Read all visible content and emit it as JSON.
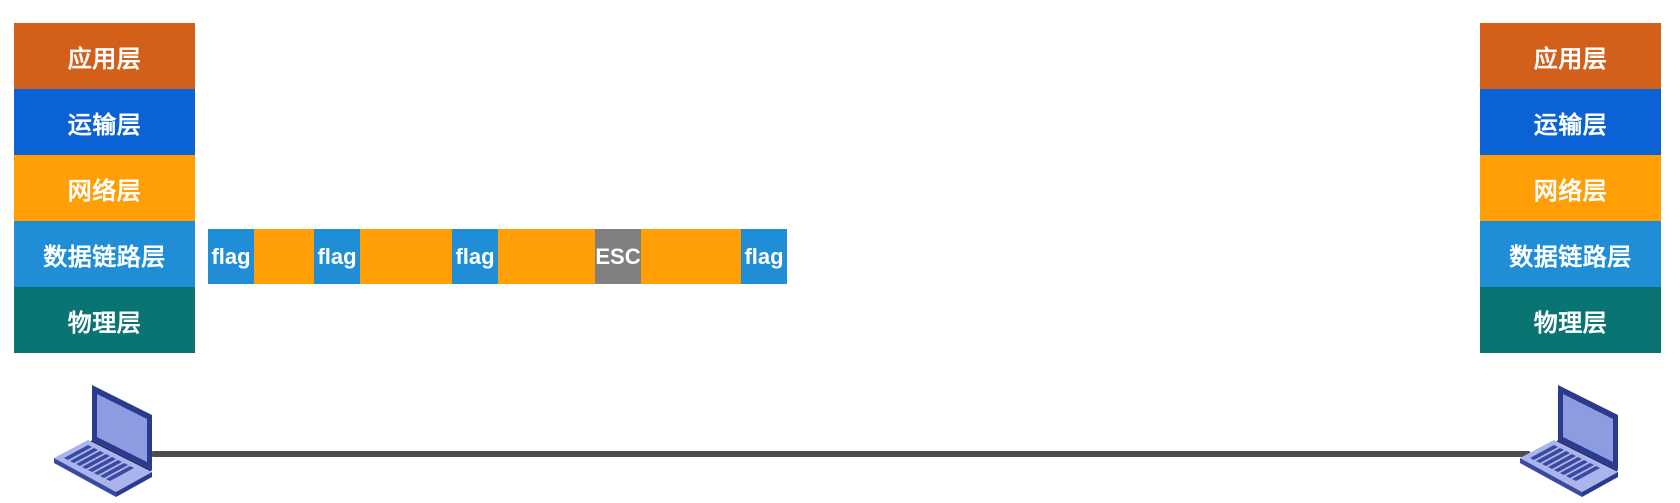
{
  "left_stack": {
    "layers": [
      {
        "label": "应用层",
        "color": "#d2601a"
      },
      {
        "label": "运输层",
        "color": "#0b62d4"
      },
      {
        "label": "网络层",
        "color": "#ff9f05"
      },
      {
        "label": "数据链路层",
        "color": "#1f8ed6"
      },
      {
        "label": "物理层",
        "color": "#0a7472"
      }
    ]
  },
  "right_stack": {
    "layers": [
      {
        "label": "应用层",
        "color": "#d2601a"
      },
      {
        "label": "运输层",
        "color": "#0b62d4"
      },
      {
        "label": "网络层",
        "color": "#ff9f05"
      },
      {
        "label": "数据链路层",
        "color": "#1f8ed6"
      },
      {
        "label": "物理层",
        "color": "#0a7472"
      }
    ]
  },
  "frame": {
    "segments": [
      {
        "label": "flag",
        "kind": "flag",
        "color": "#1f8ed6"
      },
      {
        "label": "",
        "kind": "data",
        "color": "#ff9f05"
      },
      {
        "label": "flag",
        "kind": "flag",
        "color": "#1f8ed6"
      },
      {
        "label": "",
        "kind": "data",
        "color": "#ff9f05"
      },
      {
        "label": "flag",
        "kind": "flag",
        "color": "#1f8ed6"
      },
      {
        "label": "",
        "kind": "data",
        "color": "#ff9f05"
      },
      {
        "label": "ESC",
        "kind": "escape",
        "color": "#808080"
      },
      {
        "label": "",
        "kind": "data",
        "color": "#ff9f05"
      },
      {
        "label": "flag",
        "kind": "flag",
        "color": "#1f8ed6"
      }
    ]
  },
  "link": {
    "color": "#4d4d4d"
  },
  "hosts": [
    {
      "icon": "laptop-icon"
    },
    {
      "icon": "laptop-icon"
    }
  ]
}
